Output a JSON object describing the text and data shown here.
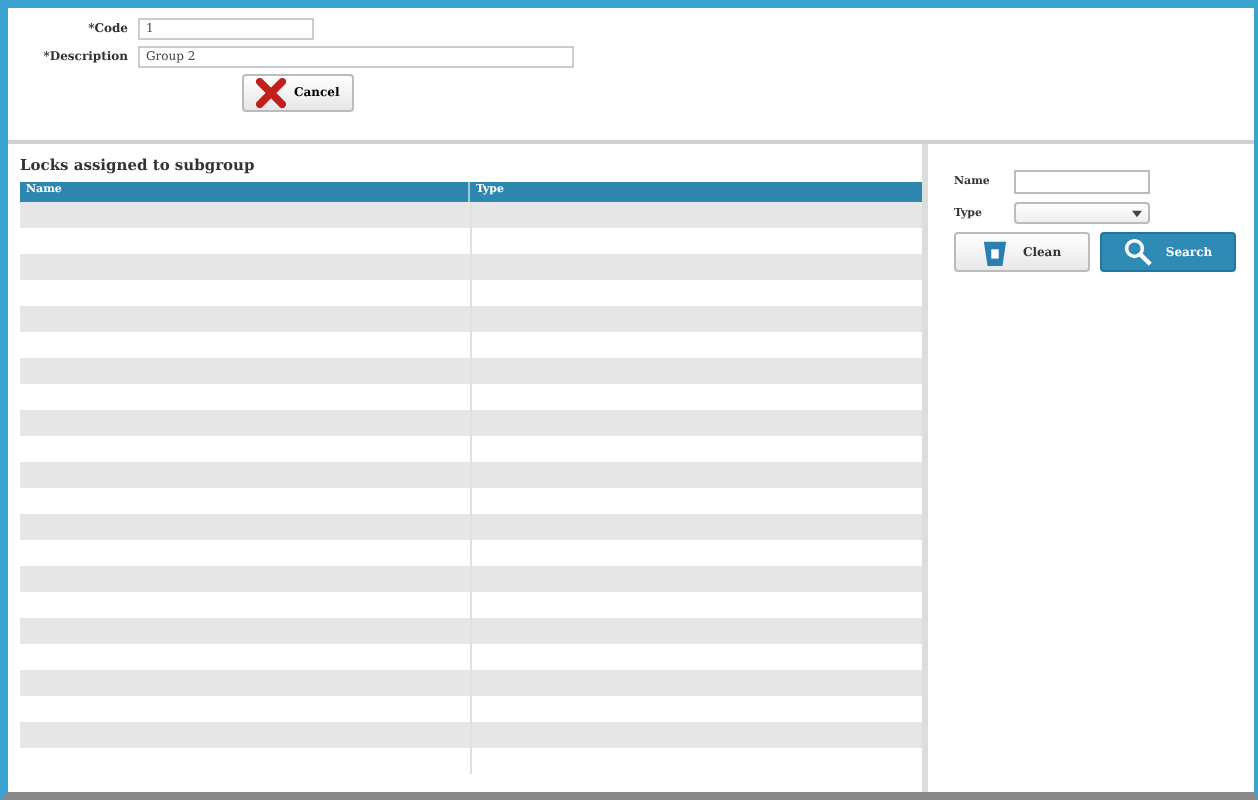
{
  "form": {
    "fields": [
      {
        "label": "*Code",
        "value": "1",
        "kind": "short"
      },
      {
        "label": "*Description",
        "value": "Group 2",
        "kind": "long"
      }
    ],
    "cancel_button": "Cancel"
  },
  "locks_panel": {
    "title": "Locks assigned to subgroup",
    "table": {
      "columns": [
        "Name",
        "Type"
      ]
    }
  },
  "filter": {
    "name_label": "Name",
    "type_label": "Type",
    "clean_button": "Clean",
    "search_button": "Search"
  }
}
